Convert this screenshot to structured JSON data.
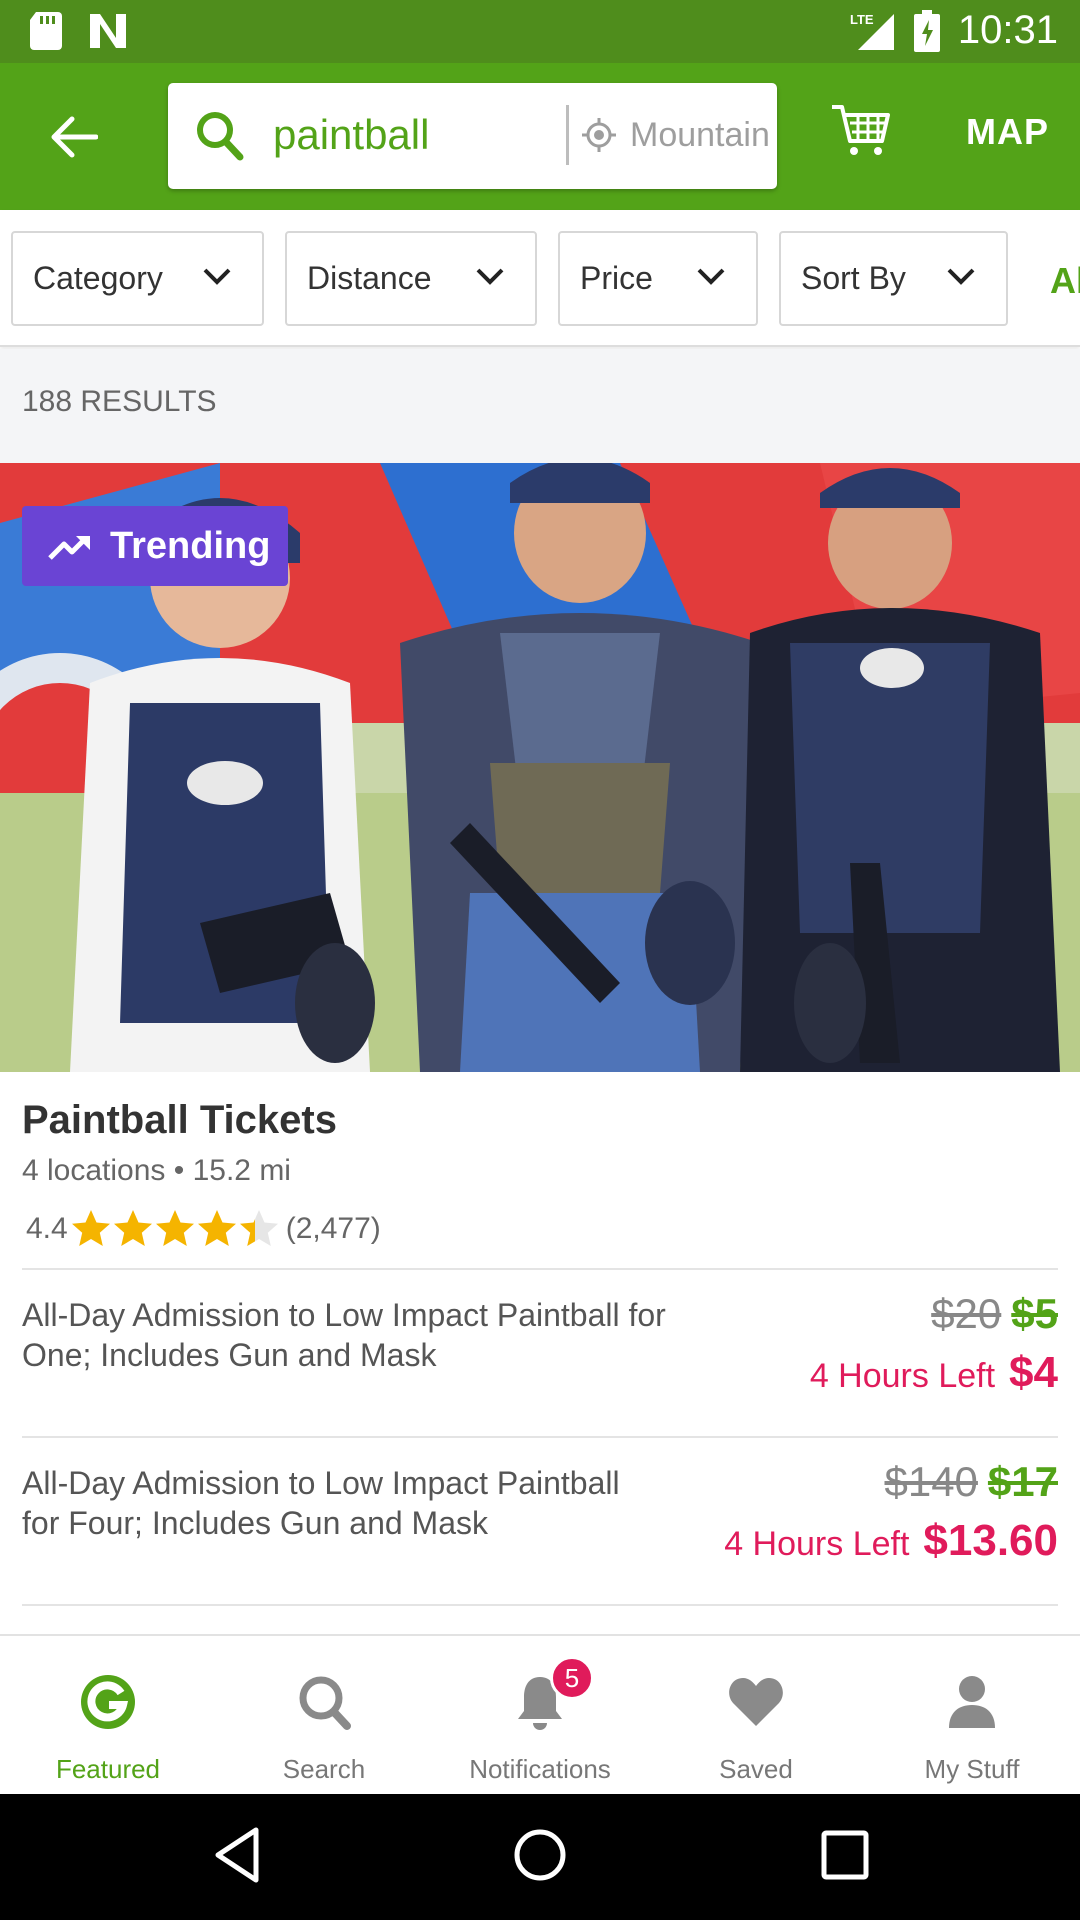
{
  "status_bar": {
    "time": "10:31",
    "network": "LTE"
  },
  "app_bar": {
    "search_query": "paintball",
    "location": "Mountain",
    "map_label": "MAP",
    "accent": "#53a318"
  },
  "filters": [
    {
      "label": "Category"
    },
    {
      "label": "Distance"
    },
    {
      "label": "Price"
    },
    {
      "label": "Sort By"
    }
  ],
  "filters_overflow": "Al",
  "results": {
    "count_label": "188 RESULTS"
  },
  "deal": {
    "badge": "Trending",
    "title": "Paintball Tickets",
    "location_line": "4 locations • 15.2 mi",
    "rating": "4.4",
    "rating_stars": 4.4,
    "rating_count": "(2,477)",
    "options": [
      {
        "desc_line1": "All-Day Admission to Low Impact Paintball for",
        "desc_line2": "One; Includes Gun and Mask",
        "original_price": "$20",
        "price": "$5",
        "urgency": "4 Hours Left",
        "final_price": "$4"
      },
      {
        "desc_line1": "All-Day Admission to Low Impact Paintball",
        "desc_line2": "for Four; Includes Gun and Mask",
        "original_price": "$140",
        "price": "$17",
        "urgency": "4 Hours Left",
        "final_price": "$13.60"
      }
    ]
  },
  "bottom_nav": [
    {
      "label": "Featured",
      "icon": "groupon-g-icon",
      "active": true
    },
    {
      "label": "Search",
      "icon": "search-icon"
    },
    {
      "label": "Notifications",
      "icon": "bell-icon",
      "badge": "5"
    },
    {
      "label": "Saved",
      "icon": "heart-icon"
    },
    {
      "label": "My Stuff",
      "icon": "person-icon"
    }
  ]
}
